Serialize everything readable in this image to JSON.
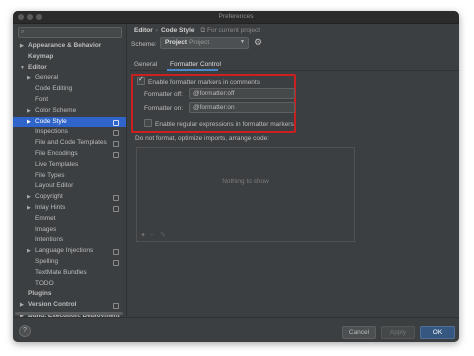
{
  "window": {
    "title": "Preferences"
  },
  "search": {
    "placeholder": ""
  },
  "sidebar": {
    "items": [
      {
        "label": "Appearance & Behavior",
        "bold": true,
        "arrow": "right",
        "project_icon": false,
        "selected": false
      },
      {
        "label": "Keymap",
        "bold": true,
        "arrow": "",
        "project_icon": false,
        "selected": false
      },
      {
        "label": "Editor",
        "bold": true,
        "arrow": "down",
        "project_icon": false,
        "selected": false
      },
      {
        "label": "General",
        "bold": false,
        "arrow": "right",
        "project_icon": false,
        "selected": false
      },
      {
        "label": "Code Editing",
        "bold": false,
        "arrow": "",
        "project_icon": false,
        "selected": false
      },
      {
        "label": "Font",
        "bold": false,
        "arrow": "",
        "project_icon": false,
        "selected": false
      },
      {
        "label": "Color Scheme",
        "bold": false,
        "arrow": "right",
        "project_icon": false,
        "selected": false
      },
      {
        "label": "Code Style",
        "bold": false,
        "arrow": "right",
        "project_icon": true,
        "selected": true
      },
      {
        "label": "Inspections",
        "bold": false,
        "arrow": "",
        "project_icon": true,
        "selected": false
      },
      {
        "label": "File and Code Templates",
        "bold": false,
        "arrow": "",
        "project_icon": true,
        "selected": false
      },
      {
        "label": "File Encodings",
        "bold": false,
        "arrow": "",
        "project_icon": true,
        "selected": false
      },
      {
        "label": "Live Templates",
        "bold": false,
        "arrow": "",
        "project_icon": false,
        "selected": false
      },
      {
        "label": "File Types",
        "bold": false,
        "arrow": "",
        "project_icon": false,
        "selected": false
      },
      {
        "label": "Layout Editor",
        "bold": false,
        "arrow": "",
        "project_icon": false,
        "selected": false
      },
      {
        "label": "Copyright",
        "bold": false,
        "arrow": "right",
        "project_icon": true,
        "selected": false
      },
      {
        "label": "Inlay Hints",
        "bold": false,
        "arrow": "right",
        "project_icon": true,
        "selected": false
      },
      {
        "label": "Emmet",
        "bold": false,
        "arrow": "",
        "project_icon": false,
        "selected": false
      },
      {
        "label": "Images",
        "bold": false,
        "arrow": "",
        "project_icon": false,
        "selected": false
      },
      {
        "label": "Intentions",
        "bold": false,
        "arrow": "",
        "project_icon": false,
        "selected": false
      },
      {
        "label": "Language Injections",
        "bold": false,
        "arrow": "right",
        "project_icon": true,
        "selected": false
      },
      {
        "label": "Spelling",
        "bold": false,
        "arrow": "",
        "project_icon": true,
        "selected": false
      },
      {
        "label": "TextMate Bundles",
        "bold": false,
        "arrow": "",
        "project_icon": false,
        "selected": false
      },
      {
        "label": "TODO",
        "bold": false,
        "arrow": "",
        "project_icon": false,
        "selected": false
      },
      {
        "label": "Plugins",
        "bold": true,
        "arrow": "",
        "project_icon": false,
        "selected": false
      },
      {
        "label": "Version Control",
        "bold": true,
        "arrow": "right",
        "project_icon": true,
        "selected": false
      },
      {
        "label": "Build, Execution, Deployment",
        "bold": true,
        "arrow": "right",
        "project_icon": false,
        "selected": false
      }
    ]
  },
  "breadcrumb": {
    "parent": "Editor",
    "separator": "›",
    "current": "Code Style",
    "scope": "For current project"
  },
  "scheme": {
    "label": "Scheme:",
    "value_bold": "Project",
    "value_dim": "Project"
  },
  "tabs": [
    {
      "label": "General",
      "active": false
    },
    {
      "label": "Formatter Control",
      "active": true
    }
  ],
  "formatter": {
    "enable_label": "Enable formatter markers in comments",
    "enable_checked": true,
    "off_label": "Formatter off:",
    "off_value": "@formatter:off",
    "on_label": "Formatter on:",
    "on_value": "@formatter:on",
    "regex_label": "Enable regular expressions in formatter markers",
    "regex_checked": false
  },
  "do_not_format": {
    "label": "Do not format, optimize imports, arrange code:",
    "empty_text": "Nothing to show"
  },
  "list_toolbar": {
    "add": "+",
    "remove": "−",
    "edit": "✎"
  },
  "buttons": {
    "help": "?",
    "cancel": "Cancel",
    "apply": "Apply",
    "ok": "OK"
  },
  "colors": {
    "accent": "#2f65ca",
    "ok_button": "#365880",
    "highlight_border": "#cc1f1f",
    "background": "#3c3f41"
  }
}
